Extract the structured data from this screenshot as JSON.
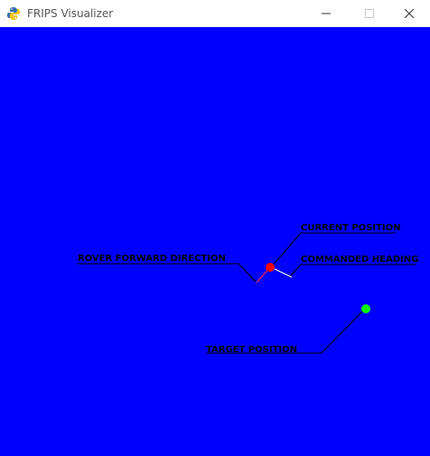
{
  "window": {
    "title": "FRIPS Visualizer",
    "app_icon": "python-icon"
  },
  "controls": {
    "minimize_icon": "minimize-icon",
    "maximize_icon": "maximize-icon",
    "close_icon": "close-icon"
  },
  "canvas": {
    "background": "#0000ff",
    "labels": {
      "current_position": "CURRENT POSITION",
      "commanded_heading": "COMMANDED HEADING",
      "rover_forward_direction": "ROVER FORWARD DIRECTION",
      "target_position": "TARGET POSITION"
    },
    "colors": {
      "rover": "#ff0000",
      "target": "#00ff00",
      "commanded_heading": "#ffffff",
      "forward_direction": "#ff3030",
      "label_text": "#000000"
    }
  }
}
